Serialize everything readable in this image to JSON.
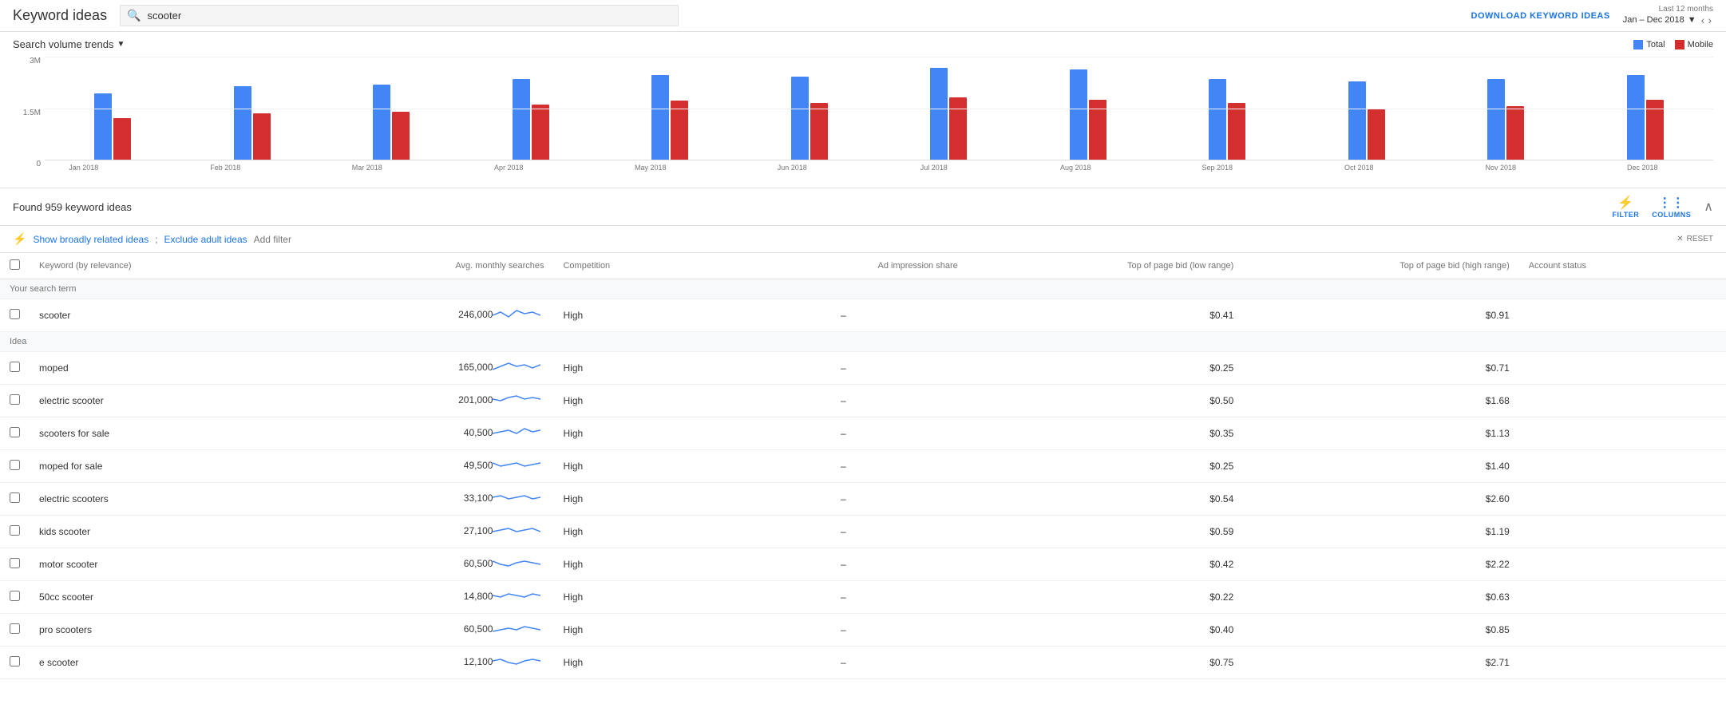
{
  "header": {
    "title": "Keyword ideas",
    "search_value": "scooter",
    "search_placeholder": "scooter",
    "download_label": "DOWNLOAD KEYWORD IDEAS",
    "date_range_label": "Last 12 months",
    "date_range_value": "Jan – Dec 2018"
  },
  "chart": {
    "title": "Search volume trends",
    "legend": {
      "total_label": "Total",
      "mobile_label": "Mobile"
    },
    "y_labels": [
      "3M",
      "1.5M",
      "0"
    ],
    "months": [
      {
        "label": "Jan 2018",
        "total": 72,
        "mobile": 45
      },
      {
        "label": "Feb 2018",
        "total": 80,
        "mobile": 50
      },
      {
        "label": "Mar 2018",
        "total": 82,
        "mobile": 52
      },
      {
        "label": "Apr 2018",
        "total": 88,
        "mobile": 60
      },
      {
        "label": "May 2018",
        "total": 92,
        "mobile": 64
      },
      {
        "label": "Jun 2018",
        "total": 90,
        "mobile": 62
      },
      {
        "label": "Jul 2018",
        "total": 100,
        "mobile": 68
      },
      {
        "label": "Aug 2018",
        "total": 98,
        "mobile": 65
      },
      {
        "label": "Sep 2018",
        "total": 88,
        "mobile": 62
      },
      {
        "label": "Oct 2018",
        "total": 85,
        "mobile": 55
      },
      {
        "label": "Nov 2018",
        "total": 88,
        "mobile": 58
      },
      {
        "label": "Dec 2018",
        "total": 92,
        "mobile": 65
      }
    ]
  },
  "results": {
    "count_text": "Found 959 keyword ideas",
    "filter_label": "FILTER",
    "columns_label": "COLUMNS",
    "reset_label": "RESET",
    "filter_show": "Show broadly related ideas",
    "filter_exclude": "Exclude adult ideas",
    "filter_add": "Add filter"
  },
  "table": {
    "headers": {
      "keyword": "Keyword (by relevance)",
      "searches": "Avg. monthly searches",
      "competition": "Competition",
      "impression": "Ad impression share",
      "bid_low": "Top of page bid (low range)",
      "bid_high": "Top of page bid (high range)",
      "account": "Account status"
    },
    "search_term_label": "Your search term",
    "idea_label": "Idea",
    "rows": [
      {
        "section": "search_term",
        "keyword": "scooter",
        "searches": "246,000",
        "competition": "High",
        "impression": "–",
        "bid_low": "$0.41",
        "bid_high": "$0.91",
        "account": ""
      },
      {
        "section": "idea",
        "keyword": "moped",
        "searches": "165,000",
        "competition": "High",
        "impression": "–",
        "bid_low": "$0.25",
        "bid_high": "$0.71",
        "account": ""
      },
      {
        "section": "idea",
        "keyword": "electric scooter",
        "searches": "201,000",
        "competition": "High",
        "impression": "–",
        "bid_low": "$0.50",
        "bid_high": "$1.68",
        "account": ""
      },
      {
        "section": "idea",
        "keyword": "scooters for sale",
        "searches": "40,500",
        "competition": "High",
        "impression": "–",
        "bid_low": "$0.35",
        "bid_high": "$1.13",
        "account": ""
      },
      {
        "section": "idea",
        "keyword": "moped for sale",
        "searches": "49,500",
        "competition": "High",
        "impression": "–",
        "bid_low": "$0.25",
        "bid_high": "$1.40",
        "account": ""
      },
      {
        "section": "idea",
        "keyword": "electric scooters",
        "searches": "33,100",
        "competition": "High",
        "impression": "–",
        "bid_low": "$0.54",
        "bid_high": "$2.60",
        "account": ""
      },
      {
        "section": "idea",
        "keyword": "kids scooter",
        "searches": "27,100",
        "competition": "High",
        "impression": "–",
        "bid_low": "$0.59",
        "bid_high": "$1.19",
        "account": ""
      },
      {
        "section": "idea",
        "keyword": "motor scooter",
        "searches": "60,500",
        "competition": "High",
        "impression": "–",
        "bid_low": "$0.42",
        "bid_high": "$2.22",
        "account": ""
      },
      {
        "section": "idea",
        "keyword": "50cc scooter",
        "searches": "14,800",
        "competition": "High",
        "impression": "–",
        "bid_low": "$0.22",
        "bid_high": "$0.63",
        "account": ""
      },
      {
        "section": "idea",
        "keyword": "pro scooters",
        "searches": "60,500",
        "competition": "High",
        "impression": "–",
        "bid_low": "$0.40",
        "bid_high": "$0.85",
        "account": ""
      },
      {
        "section": "idea",
        "keyword": "e scooter",
        "searches": "12,100",
        "competition": "High",
        "impression": "–",
        "bid_low": "$0.75",
        "bid_high": "$2.71",
        "account": ""
      }
    ]
  }
}
